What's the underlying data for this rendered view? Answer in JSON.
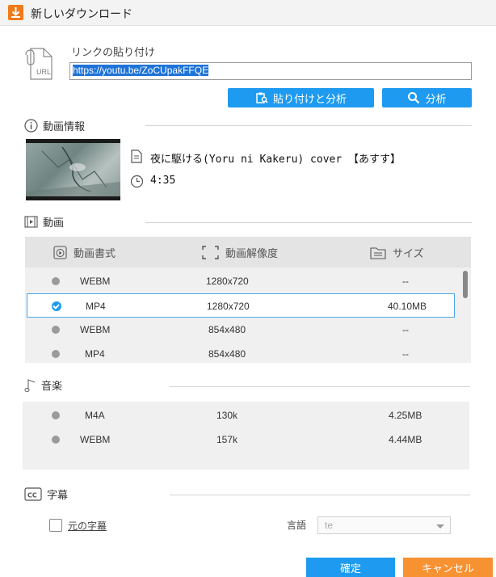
{
  "window": {
    "title": "新しいダウンロード"
  },
  "link": {
    "label": "リンクの貼り付け",
    "url_value": "https://youtu.be/ZoCUpakFFQE",
    "paste_analyze_label": "貼り付けと分析",
    "analyze_label": "分析",
    "url_icon_text": "URL"
  },
  "video_info": {
    "section_label": "動画情報",
    "title": "夜に駆ける(Yoru ni Kakeru) cover 【あすす】",
    "duration": "4:35"
  },
  "video": {
    "section_label": "動画",
    "headers": {
      "format": "動画書式",
      "resolution": "動画解像度",
      "size": "サイズ"
    },
    "rows": [
      {
        "format": "WEBM",
        "resolution": "1280x720",
        "size": "--",
        "selected": false
      },
      {
        "format": "MP4",
        "resolution": "1280x720",
        "size": "40.10MB",
        "selected": true
      },
      {
        "format": "WEBM",
        "resolution": "854x480",
        "size": "--",
        "selected": false
      },
      {
        "format": "MP4",
        "resolution": "854x480",
        "size": "--",
        "selected": false
      }
    ]
  },
  "music": {
    "section_label": "音楽",
    "rows": [
      {
        "format": "M4A",
        "bitrate": "130k",
        "size": "4.25MB"
      },
      {
        "format": "WEBM",
        "bitrate": "157k",
        "size": "4.44MB"
      }
    ]
  },
  "subtitles": {
    "section_label": "字幕",
    "original_label": "元の字幕",
    "language_label": "言語",
    "language_value": "te",
    "cc_icon_text": "CC"
  },
  "footer": {
    "ok_label": "確定",
    "cancel_label": "キャンセル"
  },
  "colors": {
    "accent_blue": "#1e9bf0",
    "accent_orange": "#f79233",
    "app_icon": "#f07b1a"
  }
}
